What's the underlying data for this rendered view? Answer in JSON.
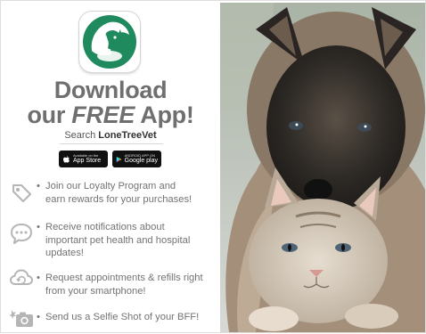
{
  "headline": {
    "line1": "Download",
    "line2_pre": "our",
    "line2_em": "FREE",
    "line2_post": "App!"
  },
  "search": {
    "label": "Search",
    "term": "LoneTreeVet"
  },
  "stores": {
    "appstore": {
      "small": "Available on the",
      "name": "App Store"
    },
    "googleplay": {
      "small": "ANDROID APP ON",
      "name": "Google play"
    }
  },
  "features": [
    {
      "icon": "tag-icon",
      "line1": "Join our Loyalty Program and",
      "line2": "earn rewards for your purchases!",
      "line3": ""
    },
    {
      "icon": "chat-bubble-icon",
      "line1": "Receive notifications about",
      "line2": "important pet health and hospital",
      "line3": "updates!"
    },
    {
      "icon": "cloud-sync-icon",
      "line1": "Request appointments & refills right",
      "line2": "from your smartphone!",
      "line3": ""
    },
    {
      "icon": "camera-icon",
      "line1": "Send us a Selfie Shot of your BFF!",
      "line2": "",
      "line3": ""
    }
  ],
  "colors": {
    "brand_green": "#1f8a5e",
    "text_gray": "#737373",
    "headline_gray": "#6f6f6f"
  }
}
